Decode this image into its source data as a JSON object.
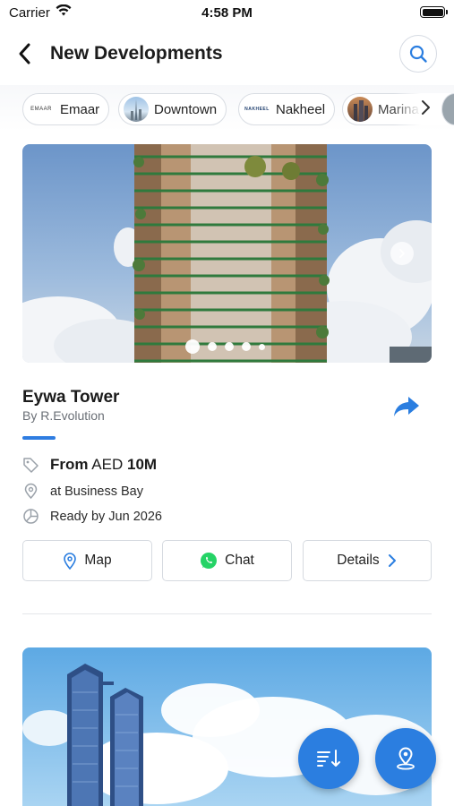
{
  "status_bar": {
    "carrier": "Carrier",
    "time": "4:58 PM"
  },
  "header": {
    "title": "New Developments"
  },
  "developer_chips": [
    {
      "label": "Emaar",
      "logo_text": "EMAAR"
    },
    {
      "label": "Downtown"
    },
    {
      "label": "Nakheel",
      "logo_text": "NAKHEEL"
    },
    {
      "label": "Marina"
    }
  ],
  "project": {
    "name": "Eywa Tower",
    "developer": "By R.Evolution",
    "price_prefix": "From",
    "price_currency": "AED",
    "price_value": "10M",
    "location": "at Business Bay",
    "ready": "Ready by Jun 2026",
    "image_slide_index": 1,
    "image_slide_count": 5
  },
  "actions": {
    "map": "Map",
    "chat": "Chat",
    "details": "Details"
  },
  "colors": {
    "accent": "#2b7ee0",
    "whatsapp": "#25d366",
    "border": "#d6dae0"
  }
}
